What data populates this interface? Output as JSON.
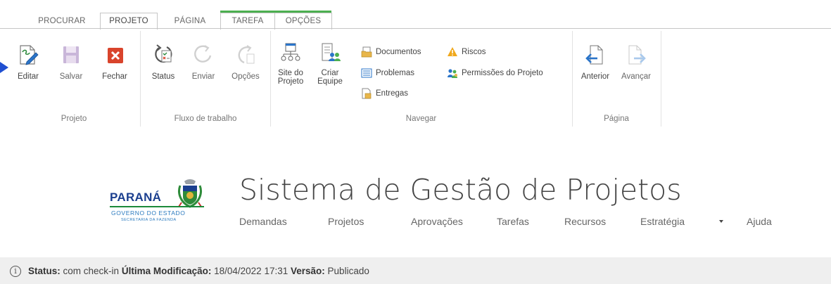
{
  "tabs": [
    {
      "label": "PROCURAR"
    },
    {
      "label": "PROJETO"
    },
    {
      "label": "PÁGINA"
    },
    {
      "label": "TAREFA"
    },
    {
      "label": "OPÇÕES"
    }
  ],
  "ribbon": {
    "projeto": {
      "group_label": "Projeto",
      "editar": "Editar",
      "salvar": "Salvar",
      "fechar": "Fechar"
    },
    "fluxo": {
      "group_label": "Fluxo de trabalho",
      "status": "Status",
      "enviar": "Enviar",
      "opcoes": "Opções"
    },
    "navegar": {
      "group_label": "Navegar",
      "site_line1": "Site do",
      "site_line2": "Projeto",
      "criar_line1": "Criar",
      "criar_line2": "Equipe",
      "documentos": "Documentos",
      "problemas": "Problemas",
      "entregas": "Entregas",
      "riscos": "Riscos",
      "permissoes": "Permissões do Projeto"
    },
    "pagina": {
      "group_label": "Página",
      "anterior": "Anterior",
      "avancar": "Avançar"
    }
  },
  "logo": {
    "word": "PARANÁ",
    "sub1": "GOVERNO DO ESTADO",
    "sub2": "SECRETARIA DA FAZENDA"
  },
  "site": {
    "title": "Sistema de Gestão de Projetos"
  },
  "nav": [
    {
      "label": "Demandas"
    },
    {
      "label": "Projetos"
    },
    {
      "label": "Aprovações"
    },
    {
      "label": "Tarefas"
    },
    {
      "label": "Recursos"
    },
    {
      "label": "Estratégia"
    },
    {
      "label": "Ajuda"
    }
  ],
  "status": {
    "status_label": "Status:",
    "status_value": "com check-in",
    "modified_label": "Última Modificação:",
    "modified_value": "18/04/2022 17:31",
    "version_label": "Versão:",
    "version_value": "Publicado"
  },
  "colors": {
    "accent": "#0072c6",
    "context_tab": "#4caf50",
    "close_red": "#d9442c",
    "status_bar": "#efefef",
    "logo_blue": "#1b3f8f"
  }
}
